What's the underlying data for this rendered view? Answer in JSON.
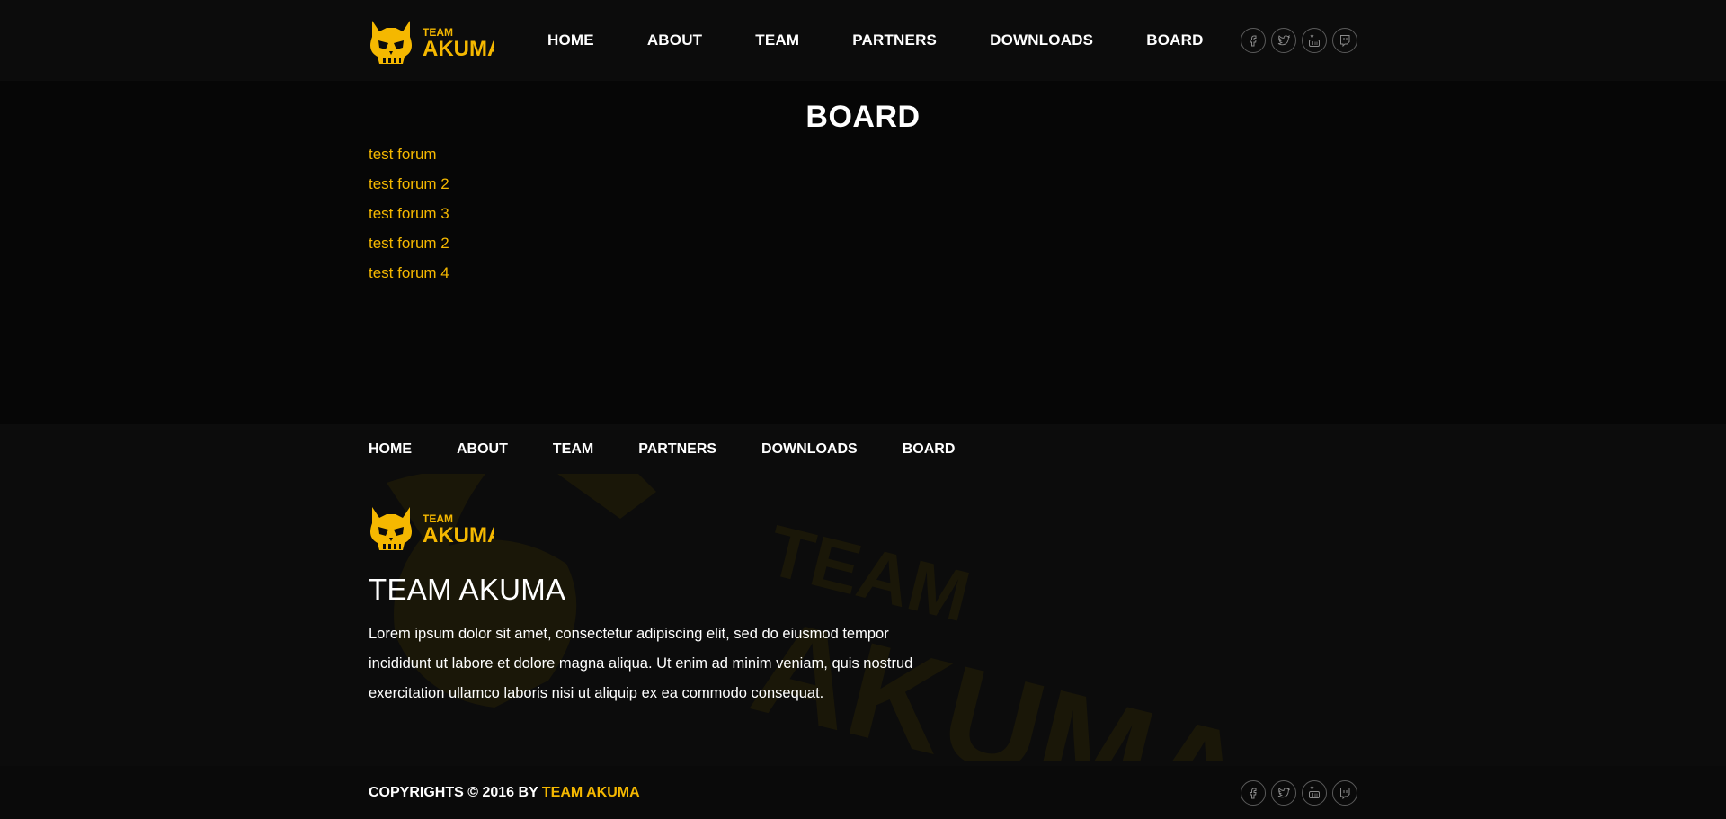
{
  "brand": {
    "logo_small": "TEAM",
    "logo_big": "AKUMA",
    "accent": "#f5b800"
  },
  "header": {
    "nav": [
      "HOME",
      "ABOUT",
      "TEAM",
      "PARTNERS",
      "DOWNLOADS",
      "BOARD"
    ],
    "socials": [
      "facebook-icon",
      "twitter-icon",
      "youtube-icon",
      "twitch-icon"
    ]
  },
  "main": {
    "title": "BOARD",
    "forums": [
      "test forum",
      "test forum 2",
      "test forum 3",
      "test forum 2",
      "test forum 4"
    ]
  },
  "footer": {
    "nav": [
      "HOME",
      "ABOUT",
      "TEAM",
      "PARTNERS",
      "DOWNLOADS",
      "BOARD"
    ],
    "about_title": "TEAM AKUMA",
    "about_text": "Lorem ipsum dolor sit amet, consectetur adipiscing elit, sed do eiusmod tempor incididunt ut labore et dolore magna aliqua. Ut enim ad minim veniam, quis nostrud exercitation ullamco laboris nisi ut aliquip ex ea commodo consequat.",
    "watermark_text": [
      "TEAM",
      "AKUMA"
    ]
  },
  "bottombar": {
    "copyright_prefix": "COPYRIGHTS © 2016 BY",
    "copyright_brand": "TEAM AKUMA"
  }
}
